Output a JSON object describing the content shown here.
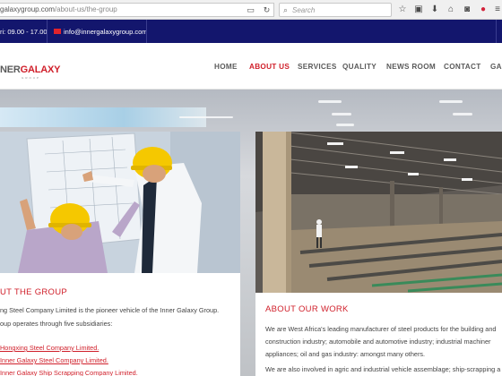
{
  "browser": {
    "url_host": "galaxygroup.com",
    "url_path": "/about-us/the-group",
    "search_placeholder": "Search"
  },
  "topbar": {
    "hours": "ri: 09.00 - 17.00",
    "email": "info@innergalaxygroup.com"
  },
  "logo": {
    "part1": "NER",
    "part2": "GALAXY",
    "sub": "GROUP"
  },
  "nav": {
    "items": [
      {
        "label": "HOME"
      },
      {
        "label": "ABOUT US",
        "active": true
      },
      {
        "label": "SERVICES"
      },
      {
        "label": "QUALITY"
      },
      {
        "label": "NEWS ROOM"
      },
      {
        "label": "CONTACT"
      },
      {
        "label": "GAL"
      }
    ]
  },
  "group_card": {
    "title": "UT THE GROUP",
    "line1": "ng Steel Company Limited is the pioneer vehicle of the Inner Galaxy Group.",
    "line2": "oup operates through five subsidiaries:",
    "links": [
      "Hongxing Steel Company Limited.",
      "Inner Galaxy Steel Company Limited.",
      "Inner Galaxy Ship Scrapping Company Limited."
    ]
  },
  "work_card": {
    "title": "ABOUT OUR WORK",
    "line1": "We are West Africa's leading manufacturer of steel products for the building and",
    "line2": "construction industry; automobile and automotive industry; industrial machiner",
    "line3": "appliances; oil and gas industry: amongst many others.",
    "line4": "We are also involved in agric and industrial vehicle assemblage; ship-scrapping a"
  },
  "colors": {
    "brand_red": "#d01f2a",
    "topbar_navy": "#13166d"
  }
}
